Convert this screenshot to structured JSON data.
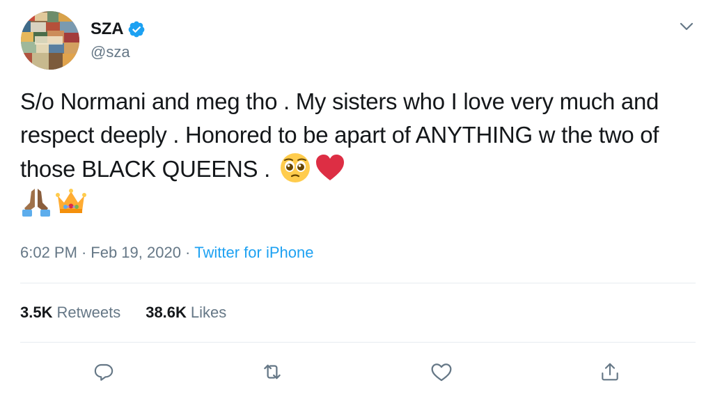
{
  "user": {
    "display_name": "SZA",
    "handle": "@sza",
    "verified": true
  },
  "tweet": {
    "text": "S/o Normani and meg tho . My sisters who I love very much and respect deeply . Honored to be apart of ANYTHING w the two of those BLACK QUEENS .",
    "emojis": [
      "pleading-face-emoji",
      "red-heart-emoji",
      "folded-hands-emoji",
      "crown-emoji"
    ]
  },
  "meta": {
    "time": "6:02 PM",
    "separator": "·",
    "date": "Feb 19, 2020",
    "source": "Twitter for iPhone"
  },
  "stats": {
    "retweets_count": "3.5K",
    "retweets_label": "Retweets",
    "likes_count": "38.6K",
    "likes_label": "Likes"
  },
  "actions": [
    "reply-icon",
    "retweet-icon",
    "like-icon",
    "share-icon"
  ],
  "colors": {
    "text": "#14171a",
    "secondary": "#657786",
    "link": "#1da1f2",
    "divider": "#e6ecf0",
    "verified": "#1da1f2"
  }
}
